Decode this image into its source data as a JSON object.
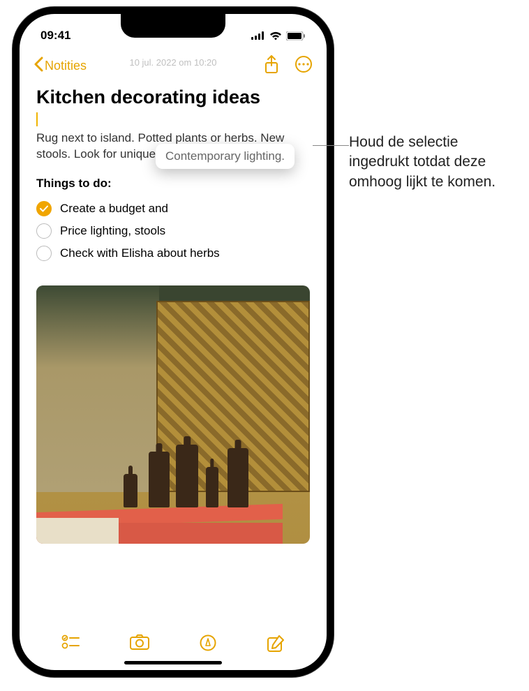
{
  "status": {
    "time": "09:41"
  },
  "nav": {
    "back_label": "Notities",
    "timestamp": "10 jul. 2022 om 10:20"
  },
  "note": {
    "title": "Kitchen decorating ideas",
    "body": "Rug next to island. Potted plants or herbs. New stools. Look for unique patterns to incorporate.",
    "things_heading": "Things to do:",
    "todos": [
      {
        "label": "Create a budget and",
        "checked": true
      },
      {
        "label": "Price lighting, stools",
        "checked": false
      },
      {
        "label": "Check with Elisha about herbs",
        "checked": false
      }
    ]
  },
  "floating_selection": "Contemporary lighting.",
  "callout": "Houd de selectie ingedrukt totdat deze omhoog lijkt te komen."
}
